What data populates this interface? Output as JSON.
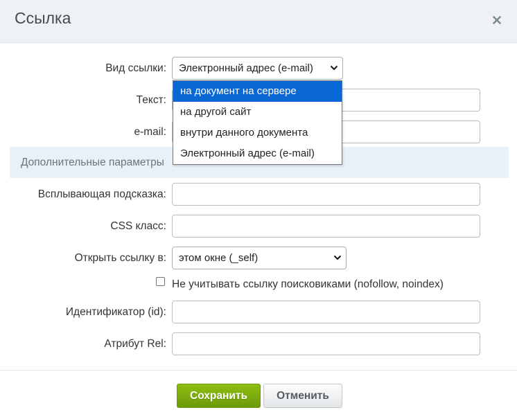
{
  "dialog": {
    "title": "Ссылка"
  },
  "form": {
    "link_type": {
      "label": "Вид ссылки:",
      "value": "Электронный адрес (e-mail)"
    },
    "text": {
      "label": "Текст:",
      "value": ""
    },
    "email": {
      "label": "e-mail:",
      "value": ""
    },
    "dropdown_options": [
      "на документ на сервере",
      "на другой сайт",
      "внутри данного документа",
      "Электронный адрес (e-mail)"
    ],
    "highlighted_option": "на документ на сервере",
    "section_title": "Дополнительные параметры",
    "tooltip": {
      "label": "Всплывающая подсказка:",
      "value": ""
    },
    "css_class": {
      "label": "CSS класс:",
      "value": ""
    },
    "target": {
      "label": "Открыть ссылку в:",
      "value": "этом окне (_self)"
    },
    "nofollow": {
      "label": "Не учитывать ссылку поисковиками (nofollow, noindex)",
      "checked": false
    },
    "id_field": {
      "label": "Идентификатор (id):",
      "value": ""
    },
    "rel": {
      "label": "Атрибут Rel:",
      "value": ""
    }
  },
  "buttons": {
    "save": "Сохранить",
    "cancel": "Отменить"
  },
  "colors": {
    "header_bg": "#eef2f4",
    "section_bg": "#e8f1f8",
    "save_button": "#7aab0e",
    "highlight": "#0a68d4"
  },
  "icons": {
    "close": "close-icon",
    "select_arrow": "chevron-down-icon"
  }
}
